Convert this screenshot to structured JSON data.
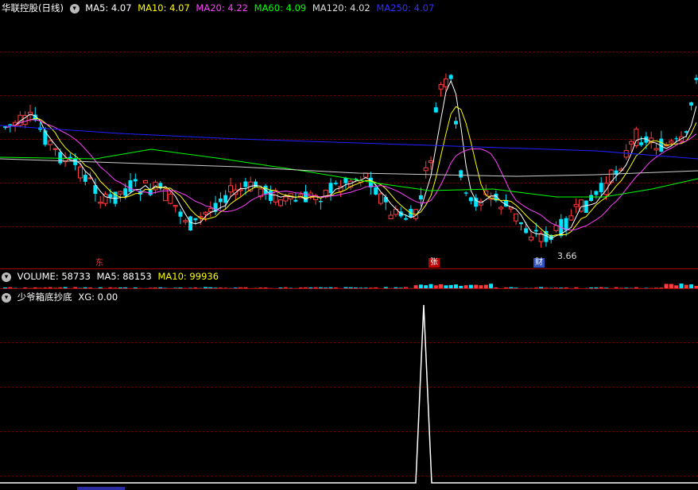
{
  "main_header": {
    "title": "华联控股(日线)",
    "ma5": "MA5: 4.07",
    "ma10": "MA10: 4.07",
    "ma20": "MA20: 4.22",
    "ma60": "MA60: 4.09",
    "ma120": "MA120: 4.02",
    "ma250": "MA250: 4.07"
  },
  "volume_header": {
    "label": "VOLUME: 58733",
    "ma5": "MA5: 88153",
    "ma10": "MA10: 99936"
  },
  "indicator_header": {
    "name": "少爷箱底抄底",
    "xg": "XG: 0.00"
  },
  "markers": {
    "low_price": "3.66",
    "zhang": "张",
    "cai": "财",
    "dong": "东"
  },
  "colors": {
    "up": "#ff3b3b",
    "down": "#00e5ff",
    "ma5": "#ffffff",
    "ma10": "#ffff00",
    "ma20": "#ff40ff",
    "ma60": "#00ff00",
    "ma120": "#cccccc",
    "ma250": "#2020ff",
    "grid": "#8b0000"
  }
}
